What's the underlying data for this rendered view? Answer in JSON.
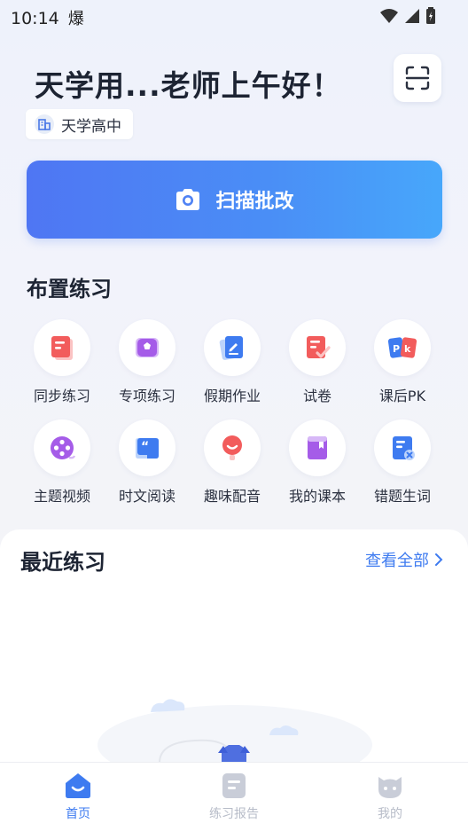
{
  "status": {
    "time": "10:14",
    "weather_glyph": "爆"
  },
  "header": {
    "greeting": "天学用...老师上午好！",
    "school": "天学高中"
  },
  "scan": {
    "label": "扫描批改"
  },
  "assign": {
    "title": "布置练习",
    "items": [
      {
        "label": "同步练习",
        "icon": "sync-practice-icon",
        "color": "#f25c5c"
      },
      {
        "label": "专项练习",
        "icon": "special-practice-icon",
        "color": "#a55ce8"
      },
      {
        "label": "假期作业",
        "icon": "holiday-homework-icon",
        "color": "#3e7bf0"
      },
      {
        "label": "试卷",
        "icon": "exam-paper-icon",
        "color": "#f25c5c"
      },
      {
        "label": "课后PK",
        "icon": "after-class-pk-icon",
        "color": "#3e7bf0"
      },
      {
        "label": "主题视频",
        "icon": "theme-video-icon",
        "color": "#a55ce8"
      },
      {
        "label": "时文阅读",
        "icon": "reading-icon",
        "color": "#3e7bf0"
      },
      {
        "label": "趣味配音",
        "icon": "dubbing-icon",
        "color": "#f25c5c"
      },
      {
        "label": "我的课本",
        "icon": "textbook-icon",
        "color": "#a55ce8"
      },
      {
        "label": "错题生词",
        "icon": "wrong-words-icon",
        "color": "#3e7bf0"
      }
    ]
  },
  "recent": {
    "title": "最近练习",
    "view_all": "查看全部"
  },
  "tabbar": {
    "tabs": [
      {
        "label": "首页",
        "active": true
      },
      {
        "label": "练习报告",
        "active": false
      },
      {
        "label": "我的",
        "active": false
      }
    ]
  },
  "colors": {
    "accent": "#3e7bf0",
    "inactive": "#b7bcc8"
  }
}
